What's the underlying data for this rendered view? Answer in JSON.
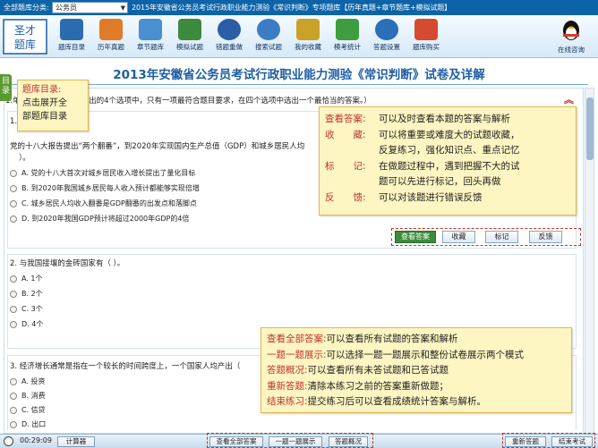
{
  "topbar": {
    "category_label": "全部题库分类:",
    "category_value": "公务员",
    "title": "2015年安徽省公务员考试行政职业能力测验《常识判断》专项题库【历年真题+章节题库+模拟试题】"
  },
  "logo": {
    "text": "圣才题库"
  },
  "toolbar": {
    "items": [
      {
        "label": "题库目录",
        "icon": "catalog-icon",
        "color": "#2b6cb0"
      },
      {
        "label": "历年真题",
        "icon": "past-papers-icon",
        "color": "#e07b2a"
      },
      {
        "label": "章节题库",
        "icon": "chapter-icon",
        "color": "#4a8fd1"
      },
      {
        "label": "模拟试题",
        "icon": "mock-exam-icon",
        "color": "#3d8a3d"
      },
      {
        "label": "错题重做",
        "icon": "redo-icon",
        "color": "#2c5ea8"
      },
      {
        "label": "搜索试题",
        "icon": "search-icon",
        "color": "#3b7cc4"
      },
      {
        "label": "我的收藏",
        "icon": "favorites-icon",
        "color": "#c9a227"
      },
      {
        "label": "模考统计",
        "icon": "statistics-icon",
        "color": "#3f9c3f"
      },
      {
        "label": "答题设置",
        "icon": "settings-icon",
        "color": "#2a6fb8"
      },
      {
        "label": "题库购买",
        "icon": "cart-icon",
        "color": "#d64a2f"
      }
    ],
    "consult_label": "在线咨询"
  },
  "side_tab": {
    "label": "目录"
  },
  "page_title": "2013年安徽省公务员考试行政职业能力测验《常识判断》试卷及详解",
  "instruction": "1.单项选择题（每题所给出的4个选项中，只有一项最符合题目要求，在四个选项中选出一个最恰当的答案。）",
  "questions": [
    {
      "num": "1.",
      "stem": "党的十八大报告提出“两个翻番”，到2020年实现国内生产总值（GDP）和城乡居民人均",
      "stem2": "）。",
      "options": [
        "A. 党的十八大首次对城乡居民收入增长提出了量化目标",
        "B. 到2020年我国城乡居民每人收入预计都能够实现倍增",
        "C. 城乡居民人均收入翻番是GDP翻番的出发点和落脚点",
        "D. 到2020年我国GDP预计将超过2000年GDP的4倍"
      ]
    },
    {
      "num": "2.",
      "stem": "2. 与我国接壤的金砖国家有（    ）。",
      "options": [
        "A. 1个",
        "B. 2个",
        "C. 3个",
        "D. 4个"
      ]
    },
    {
      "num": "3.",
      "stem": "3. 经济增长通常是指在一个较长的时间跨度上，一个国家人均产出（",
      "options": [
        "A. 投资",
        "B. 消费",
        "C. 信贷",
        "D. 出口"
      ]
    }
  ],
  "question_actions": {
    "view_answer": "查看答案",
    "favorite": "收藏",
    "mark": "标记",
    "feedback": "反馈"
  },
  "callout_left": {
    "title": "题库目录:",
    "line1": "点击展开全",
    "line2": "部题库目录"
  },
  "callout_right": [
    {
      "k": "查看答案:",
      "v": "可以及时查看本题的答案与解析"
    },
    {
      "k": "收　　藏:",
      "v": "可以将重要或难度大的试题收藏，"
    },
    {
      "k": "",
      "v": "反复练习，强化知识点、重点记忆"
    },
    {
      "k": "标　　记:",
      "v": "在做题过程中，遇到把握不大的试"
    },
    {
      "k": "",
      "v": "题可以先进行标记，回头再做"
    },
    {
      "k": "反　　馈:",
      "v": "可以对该题进行错误反馈"
    }
  ],
  "callout_bottom": [
    {
      "k": "查看全部答案:",
      "v": "可以查看所有试题的答案和解析"
    },
    {
      "k": "一题一题展示:",
      "v": "可以选择一题一题展示和整份试卷展示两个模式"
    },
    {
      "k": "答题概况:",
      "v": "可以查看所有未答试题和已答试题"
    },
    {
      "k": "重新答题:",
      "v": "清除本练习之前的答案重新做题；"
    },
    {
      "k": "结束练习:",
      "v": "提交练习后可以查看成绩统计答案与解析。"
    }
  ],
  "bottombar": {
    "timer": "00:29:09",
    "calculator": "计算器",
    "view_all": "查看全部答案",
    "one_by_one": "一题一题展示",
    "overview": "答题概况",
    "restart": "重新答题",
    "finish": "结束考试"
  }
}
